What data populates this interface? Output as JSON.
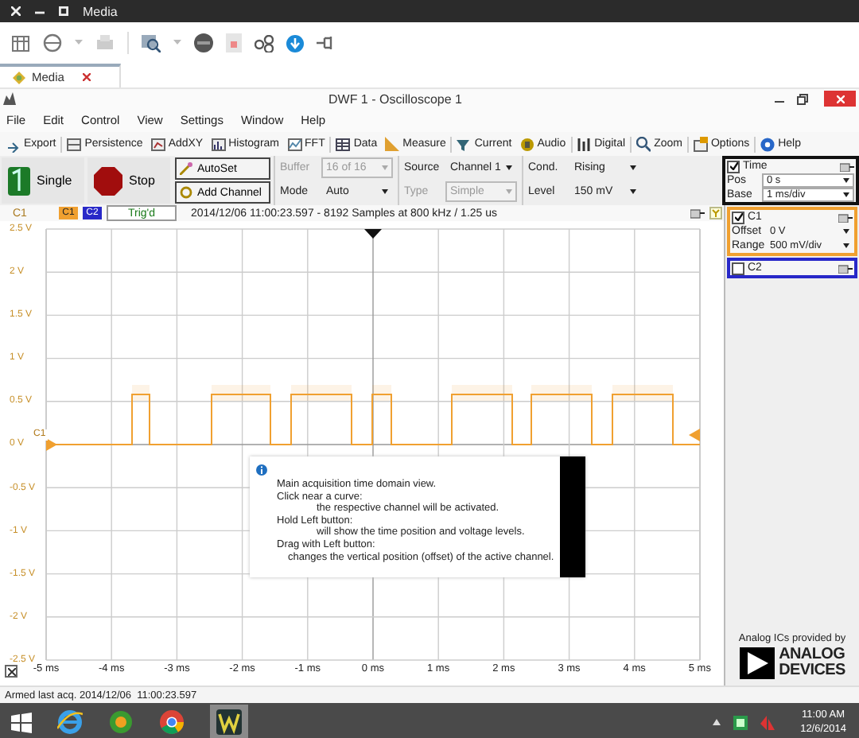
{
  "window": {
    "title": "Media"
  },
  "tabs": [
    {
      "label": "Media",
      "selected": true
    }
  ],
  "document": {
    "title": "DWF 1 - Oscilloscope 1"
  },
  "menu": [
    "File",
    "Edit",
    "Control",
    "View",
    "Settings",
    "Window",
    "Help"
  ],
  "toolbar": [
    "Export",
    "Persistence",
    "AddXY",
    "Histogram",
    "FFT",
    "Data",
    "Measure",
    "Current",
    "Audio",
    "Digital",
    "Zoom",
    "Options",
    "Help"
  ],
  "acquisition": {
    "single": "Single",
    "stop": "Stop",
    "autoset": "AutoSet",
    "add_channel": "Add Channel"
  },
  "trigger_fields": [
    {
      "label": "Buffer",
      "value": "16 of 16",
      "disabled": true
    },
    {
      "label": "Mode",
      "value": "Auto",
      "disabled": false
    },
    {
      "label": "Source",
      "value": "Channel 1",
      "disabled": false
    },
    {
      "label": "Type",
      "value": "Simple",
      "disabled": true
    },
    {
      "label": "Cond.",
      "value": "Rising",
      "disabled": false
    },
    {
      "label": "Level",
      "value": "150 mV",
      "disabled": false
    }
  ],
  "time_panel": {
    "title": "Time",
    "checked": true,
    "fields": [
      {
        "label": "Pos",
        "value": "0 s"
      },
      {
        "label": "Base",
        "value": "1 ms/div"
      }
    ]
  },
  "plot": {
    "axis_channel": "C1",
    "channel_tags": [
      "C1",
      "C2"
    ],
    "status": "Trig'd",
    "info": "2014/12/06 11:00:23.597 - 8192 Samples at 800 kHz / 1.25 us",
    "level_marker": "C1",
    "y_labels": [
      "2.5 V",
      "2 V",
      "1.5 V",
      "1 V",
      "0.5 V",
      "0 V",
      "-0.5 V",
      "-1 V",
      "-1.5 V",
      "-2 V",
      "-2.5 V"
    ],
    "x_labels": [
      "-5 ms",
      "-4 ms",
      "-3 ms",
      "-2 ms",
      "-1 ms",
      "0 ms",
      "1 ms",
      "2 ms",
      "3 ms",
      "4 ms",
      "5 ms"
    ],
    "tooltip": [
      {
        "text": "Main acquisition time domain view."
      },
      {
        "text": "Click near a curve:",
        "children": [
          {
            "text": "the respective channel will be activated."
          }
        ]
      },
      {
        "text": "Hold Left button:",
        "children": [
          {
            "text": "will show the time position and voltage levels."
          }
        ]
      },
      {
        "text": "Drag with Left button:",
        "children": [
          {
            "text": "changes the vertical position (offset) of the active channel."
          }
        ]
      }
    ]
  },
  "channels": [
    {
      "name": "C1",
      "checked": true,
      "color": "#f0a030",
      "fields": [
        {
          "label": "Offset",
          "value": "0 V"
        },
        {
          "label": "Range",
          "value": "500 mV/div"
        }
      ]
    },
    {
      "name": "C2",
      "checked": false,
      "color": "#2828c8"
    }
  ],
  "logo": {
    "caption": "Analog ICs provided by",
    "brand": [
      "ANALOG",
      "DEVICES"
    ]
  },
  "status_bar": "Armed last acq. 2014/12/06  11:00:23.597",
  "taskbar": {
    "time": "11:00 AM",
    "date": "12/6/2014"
  }
}
